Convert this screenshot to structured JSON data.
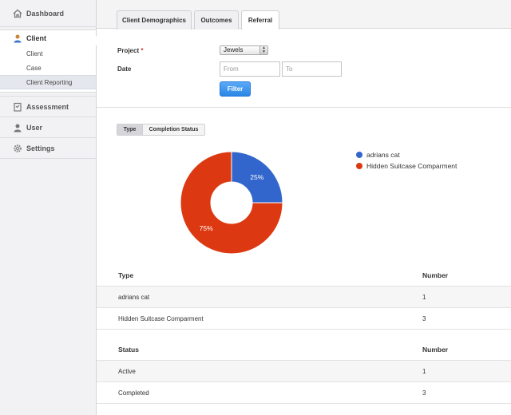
{
  "sidebar": {
    "items": [
      {
        "label": "Dashboard",
        "icon": "home-icon"
      },
      {
        "label": "Client",
        "icon": "user-icon"
      },
      {
        "label": "Assessment",
        "icon": "checklist-icon"
      },
      {
        "label": "User",
        "icon": "user-icon"
      },
      {
        "label": "Settings",
        "icon": "gear-icon"
      }
    ],
    "client_sub": [
      "Client",
      "Case",
      "Client Reporting"
    ]
  },
  "tabs": [
    "Client Demographics",
    "Outcomes",
    "Referral"
  ],
  "form": {
    "project_label": "Project",
    "required_mark": "*",
    "project_value": "Jewels",
    "date_label": "Date",
    "from_placeholder": "From",
    "to_placeholder": "To",
    "filter_label": "Filter"
  },
  "segment": [
    "Type",
    "Completion Status"
  ],
  "chart_data": {
    "type": "pie",
    "donut": true,
    "categories": [
      "adrians cat",
      "Hidden Suitcase Comparment"
    ],
    "values": [
      25,
      75
    ],
    "labels": [
      "25%",
      "75%"
    ],
    "colors": [
      "#3366cc",
      "#dc3912"
    ],
    "legend": "right"
  },
  "table_type": {
    "headers": [
      "Type",
      "Number"
    ],
    "rows": [
      [
        "adrians cat",
        "1"
      ],
      [
        "Hidden Suitcase Comparment",
        "3"
      ]
    ]
  },
  "table_status": {
    "headers": [
      "Status",
      "Number"
    ],
    "rows": [
      [
        "Active",
        "1"
      ],
      [
        "Completed",
        "3"
      ]
    ]
  }
}
